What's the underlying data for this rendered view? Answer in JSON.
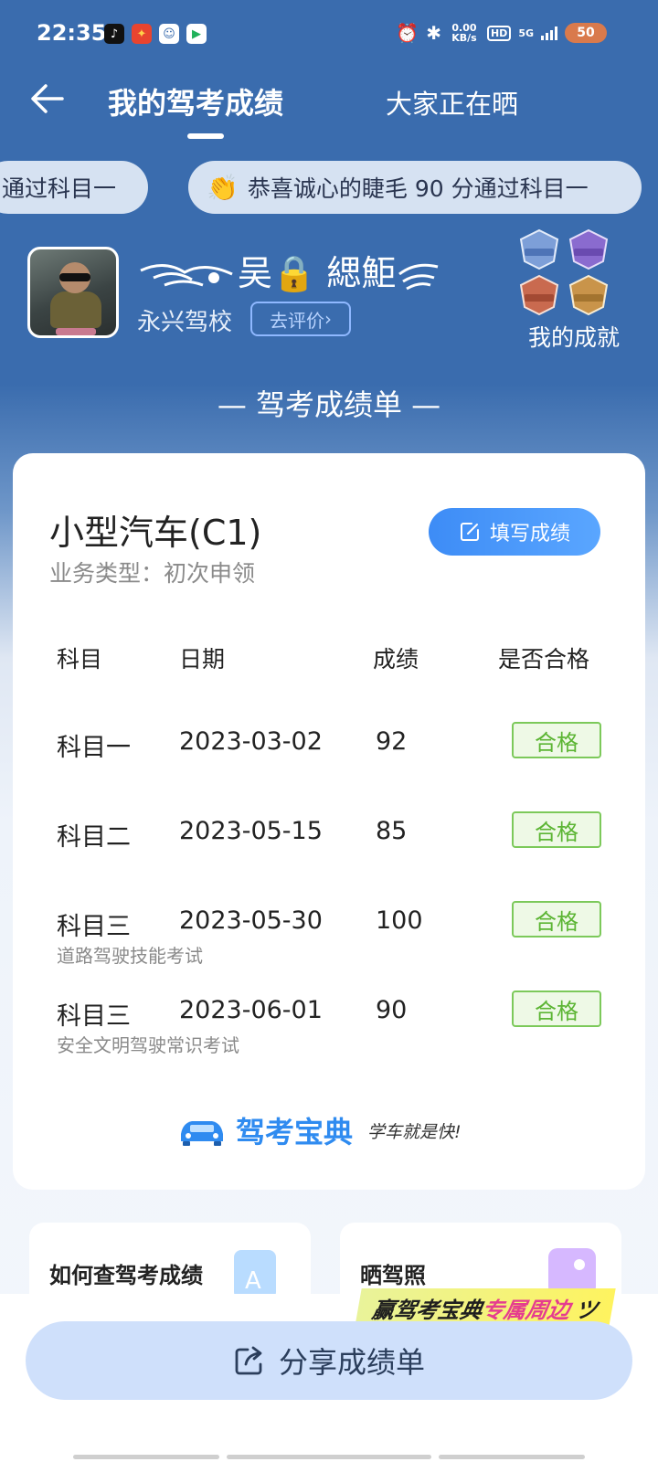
{
  "status_bar": {
    "time": "22:35",
    "net_speed": "0.00 KB/s",
    "hd": "HD",
    "network": "5G",
    "battery": "50"
  },
  "nav": {
    "tab_active": "我的驾考成绩",
    "tab_other": "大家正在晒"
  },
  "marquee": {
    "left_text": "通过科目一",
    "right_text": "恭喜诚心的睫毛 90 分通过科目一"
  },
  "profile": {
    "nickname": "吴🔒 緦鮔",
    "school": "永兴驾校",
    "evaluate_label": "去评价",
    "achievements_label": "我的成就"
  },
  "section_title": "— 驾考成绩单 —",
  "card": {
    "car_type": "小型汽车(C1)",
    "business_type": "业务类型：初次申领",
    "fill_button_label": "填写成绩",
    "headers": [
      "科目",
      "日期",
      "成绩",
      "是否合格"
    ],
    "rows": [
      {
        "subject": "科目一",
        "date": "2023-03-02",
        "score": "92",
        "result": "合格",
        "sub": ""
      },
      {
        "subject": "科目二",
        "date": "2023-05-15",
        "score": "85",
        "result": "合格",
        "sub": ""
      },
      {
        "subject": "科目三",
        "date": "2023-05-30",
        "score": "100",
        "result": "合格",
        "sub": "道路驾驶技能考试"
      },
      {
        "subject": "科目三",
        "date": "2023-06-01",
        "score": "90",
        "result": "合格",
        "sub": "安全文明驾驶常识考试"
      }
    ],
    "brand": "驾考宝典",
    "slogan": "学车就是快!"
  },
  "bottom": {
    "card_left_title": "如何查驾考成绩",
    "card_right_title": "晒驾照",
    "promo_prefix": "赢驾考宝典",
    "promo_highlight": "专属周边",
    "share_label": "分享成绩单"
  },
  "colors": {
    "header_blue": "#3a6cae",
    "accent_blue": "#3d8cf6",
    "pass_green": "#5cb534",
    "share_button_bg": "#cfe0fb"
  }
}
